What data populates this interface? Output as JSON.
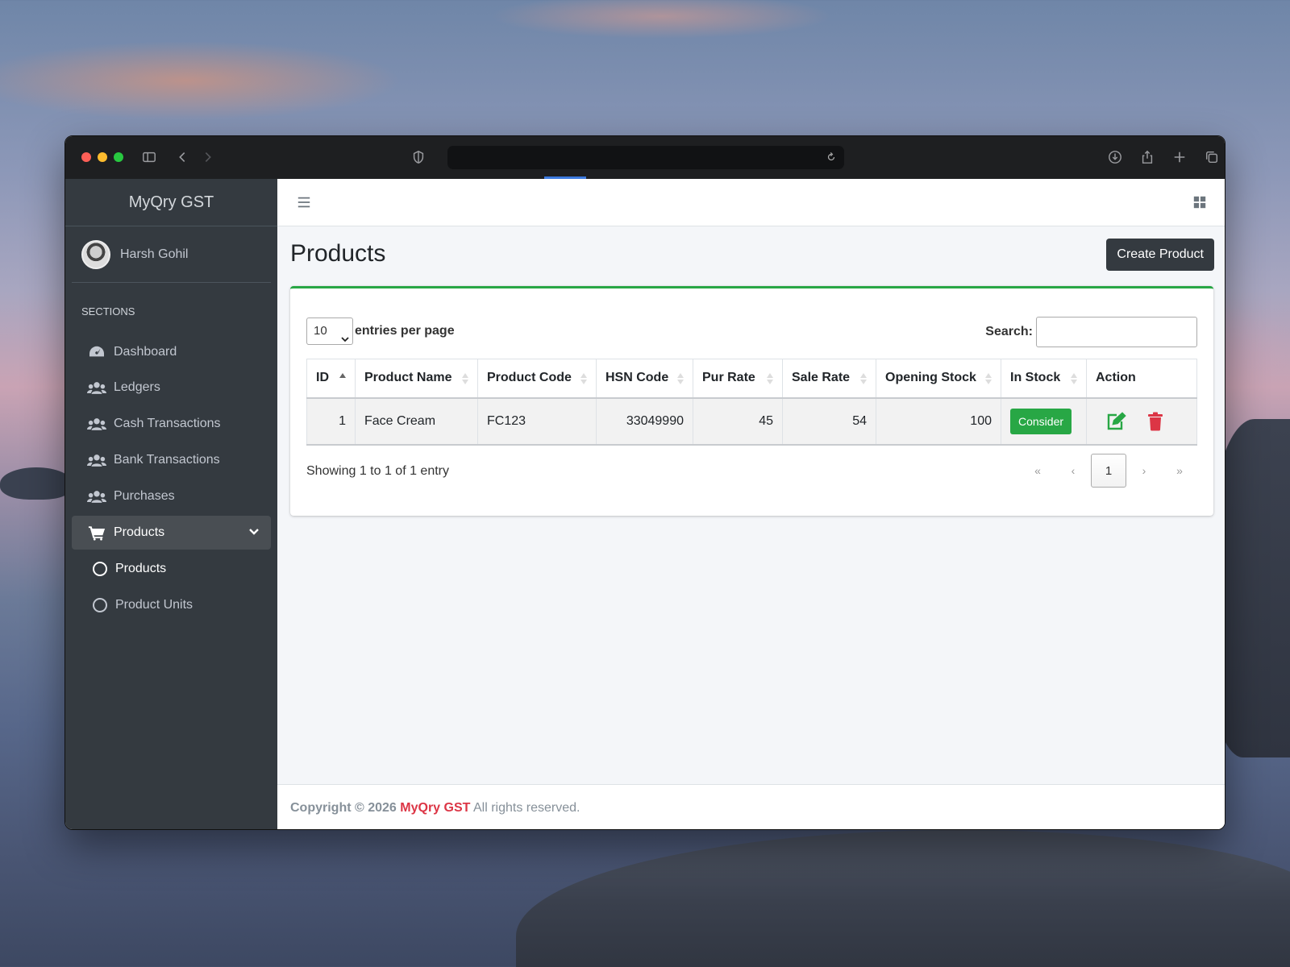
{
  "app": {
    "brand": "MyQry GST",
    "user": "Harsh Gohil",
    "section_header": "SECTIONS"
  },
  "sidebar": {
    "items": [
      {
        "label": "Dashboard",
        "icon": "tachometer-icon"
      },
      {
        "label": "Ledgers",
        "icon": "users-icon"
      },
      {
        "label": "Cash Transactions",
        "icon": "users-icon"
      },
      {
        "label": "Bank Transactions",
        "icon": "users-icon"
      },
      {
        "label": "Purchases",
        "icon": "users-icon"
      },
      {
        "label": "Products",
        "icon": "cart-icon",
        "active": true
      },
      {
        "label": "Products",
        "icon": "circle-icon",
        "sub": true
      },
      {
        "label": "Product Units",
        "icon": "circle-icon",
        "sub": true
      }
    ]
  },
  "page": {
    "title": "Products",
    "create_button": "Create Product"
  },
  "table_controls": {
    "length_value": "10",
    "length_label": "entries per page",
    "search_label": "Search:",
    "search_value": ""
  },
  "table": {
    "columns": [
      "ID",
      "Product Name",
      "Product Code",
      "HSN Code",
      "Pur Rate",
      "Sale Rate",
      "Opening Stock",
      "In Stock",
      "Action"
    ],
    "rows": [
      {
        "id": "1",
        "name": "Face Cream",
        "code": "FC123",
        "hsn": "33049990",
        "pur_rate": "45",
        "sale_rate": "54",
        "opening_stock": "100",
        "in_stock": "Consider"
      }
    ]
  },
  "pagination": {
    "info": "Showing 1 to 1 of 1 entry",
    "first": "«",
    "prev": "‹",
    "current": "1",
    "next": "›",
    "last": "»"
  },
  "footer": {
    "prefix": "Copyright © 2026",
    "brand": "MyQry GST",
    "suffix": "All rights reserved."
  },
  "colors": {
    "accent": "#28a745",
    "danger": "#dc3545",
    "sidebar_bg": "#343a40"
  }
}
